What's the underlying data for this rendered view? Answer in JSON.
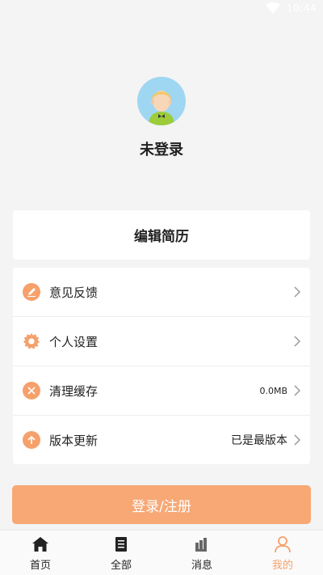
{
  "status_bar": {
    "time": "10:44",
    "icons": [
      "wifi-icon"
    ]
  },
  "profile": {
    "username": "未登录",
    "avatar_icon": "avatar-icon"
  },
  "edit_resume": {
    "label": "编辑简历"
  },
  "menu": [
    {
      "label": "意见反馈",
      "value": "",
      "icon": "feedback-icon"
    },
    {
      "label": "个人设置",
      "value": "",
      "icon": "gear-icon"
    },
    {
      "label": "清理缓存",
      "value": "0.0MB",
      "icon": "clear-icon"
    },
    {
      "label": "版本更新",
      "value": "已是最版本",
      "icon": "upload-icon"
    }
  ],
  "login_button": {
    "label": "登录/注册"
  },
  "tabs": [
    {
      "label": "首页",
      "icon": "home-icon",
      "active": false
    },
    {
      "label": "全部",
      "icon": "list-icon",
      "active": false
    },
    {
      "label": "消息",
      "icon": "message-icon",
      "active": false
    },
    {
      "label": "我的",
      "icon": "user-icon",
      "active": true
    }
  ],
  "colors": {
    "accent": "#f6a06c",
    "button": "#f7a875",
    "background": "#f4f4f4"
  }
}
